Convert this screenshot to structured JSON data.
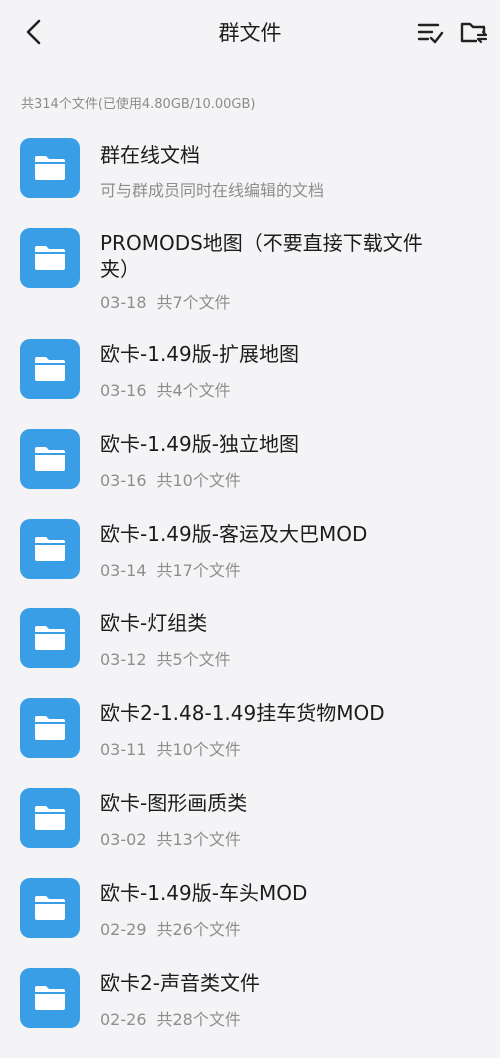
{
  "header": {
    "title": "群文件"
  },
  "summary_text": "共314个文件(已使用4.80GB/10.00GB)",
  "items": [
    {
      "name": "群在线文档",
      "date": "",
      "count": "",
      "subtitle": "可与群成员同时在线编辑的文档"
    },
    {
      "name": "PROMODS地图（不要直接下载文件夹）",
      "date": "03-18",
      "count": "共7个文件",
      "subtitle": ""
    },
    {
      "name": "欧卡-1.49版-扩展地图",
      "date": "03-16",
      "count": "共4个文件",
      "subtitle": ""
    },
    {
      "name": "欧卡-1.49版-独立地图",
      "date": "03-16",
      "count": "共10个文件",
      "subtitle": ""
    },
    {
      "name": "欧卡-1.49版-客运及大巴MOD",
      "date": "03-14",
      "count": "共17个文件",
      "subtitle": ""
    },
    {
      "name": "欧卡-灯组类",
      "date": "03-12",
      "count": "共5个文件",
      "subtitle": ""
    },
    {
      "name": "欧卡2-1.48-1.49挂车货物MOD",
      "date": "03-11",
      "count": "共10个文件",
      "subtitle": ""
    },
    {
      "name": "欧卡-图形画质类",
      "date": "03-02",
      "count": "共13个文件",
      "subtitle": ""
    },
    {
      "name": "欧卡-1.49版-车头MOD",
      "date": "02-29",
      "count": "共26个文件",
      "subtitle": ""
    },
    {
      "name": "欧卡2-声音类文件",
      "date": "02-26",
      "count": "共28个文件",
      "subtitle": ""
    }
  ],
  "colors": {
    "folder_icon": "#3a9ee6",
    "background": "#f4f4f6"
  },
  "icons": {
    "back": "chevron-left-icon",
    "sort": "sort-list-icon",
    "manage": "folder-sync-icon",
    "folder": "folder-icon"
  }
}
